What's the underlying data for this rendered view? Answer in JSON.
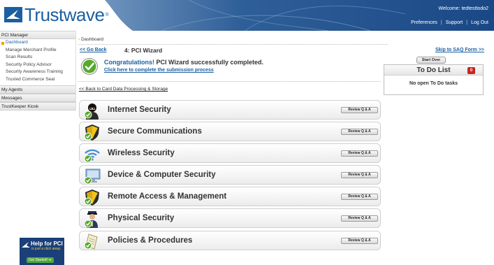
{
  "header": {
    "brand": "Trustwave",
    "brand_mark": "®",
    "welcome": "Welcome: tedtesttodo2",
    "links": [
      "Preferences",
      "Support",
      "Log Out"
    ]
  },
  "sidebar": {
    "sections": [
      {
        "title": "PCI Manager",
        "items": [
          {
            "label": "Dashboard",
            "active": true
          },
          {
            "label": "Manage Merchant Profile"
          },
          {
            "label": "Scan Results"
          },
          {
            "label": "Security Policy Advisor"
          },
          {
            "label": "Security Awareness Training"
          },
          {
            "label": "Trusted Commerce Seal"
          }
        ]
      },
      {
        "title": "My Agents",
        "items": []
      },
      {
        "title": "Messages",
        "items": []
      },
      {
        "title": "TrustKeeper Kiosk",
        "items": []
      }
    ]
  },
  "ad": {
    "title": "Help for PCI",
    "subtitle": "is just a click away.",
    "button": "Get Started!"
  },
  "main": {
    "breadcrumb": "Dashboard",
    "go_back": "<< Go Back",
    "wizard_title": "4: PCI Wizard",
    "skip_link": "Skip to SAQ Form >>",
    "congrats_highlight": "Congratulations!",
    "congrats_rest": " PCI Wizard successfully completed.",
    "congrats_link": "Click here to complete the submission process",
    "back_link": "<< Back to Card Data Processing & Storage",
    "review_label": "Review Q & A",
    "rows": [
      {
        "label": "Internet Security",
        "icon": "hacker-icon"
      },
      {
        "label": "Secure Communications",
        "icon": "shield-icon"
      },
      {
        "label": "Wireless Security",
        "icon": "wifi-icon"
      },
      {
        "label": "Device & Computer Security",
        "icon": "computer-icon"
      },
      {
        "label": "Remote Access & Management",
        "icon": "shield-icon"
      },
      {
        "label": "Physical Security",
        "icon": "guard-icon"
      },
      {
        "label": "Policies & Procedures",
        "icon": "document-icon"
      }
    ]
  },
  "todo": {
    "start_over": "Start Over",
    "title": "To Do List",
    "count": "0",
    "empty": "No open To Do tasks"
  },
  "colors": {
    "link": "#1b5fa0",
    "header_blue": "#1f4f8a",
    "check_green": "#58a82e",
    "badge_red": "#c8261e"
  }
}
